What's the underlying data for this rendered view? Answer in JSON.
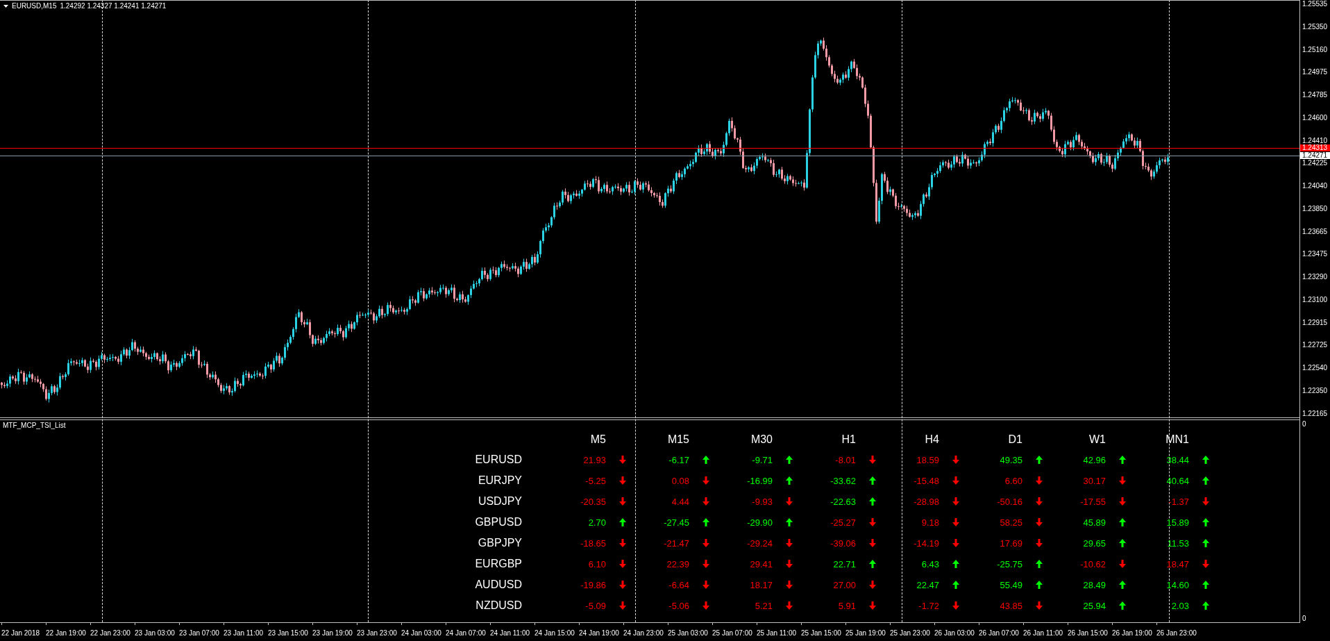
{
  "chart": {
    "symbol": "EURUSD,M15",
    "ohlc": "1.24292 1.24327 1.24241 1.24271",
    "ask_label": "1.24313",
    "bid_label": "1.24271"
  },
  "price_axis": {
    "labels": [
      "1.25535",
      "1.25350",
      "1.25160",
      "1.24975",
      "1.24785",
      "1.24600",
      "1.24410",
      "1.24225",
      "1.24040",
      "1.23850",
      "1.23665",
      "1.23475",
      "1.23290",
      "1.23100",
      "1.22915",
      "1.22725",
      "1.22540",
      "1.22350",
      "1.22165"
    ]
  },
  "indicator": {
    "name": "MTF_MCP_TSI_List",
    "axis_labels": [
      "0",
      "0"
    ],
    "timeframes": [
      "M5",
      "M15",
      "M30",
      "H1",
      "H4",
      "D1",
      "W1",
      "MN1"
    ],
    "rows": [
      {
        "symbol": "EURUSD",
        "cells": [
          {
            "value": "21.93",
            "rising": false
          },
          {
            "value": "-6.17",
            "rising": true
          },
          {
            "value": "-9.71",
            "rising": true
          },
          {
            "value": "-8.01",
            "rising": false
          },
          {
            "value": "18.59",
            "rising": false
          },
          {
            "value": "49.35",
            "rising": true
          },
          {
            "value": "42.96",
            "rising": true
          },
          {
            "value": "38.44",
            "rising": true
          }
        ]
      },
      {
        "symbol": "EURJPY",
        "cells": [
          {
            "value": "-5.25",
            "rising": false
          },
          {
            "value": "0.08",
            "rising": false
          },
          {
            "value": "-16.99",
            "rising": true
          },
          {
            "value": "-33.62",
            "rising": true
          },
          {
            "value": "-15.48",
            "rising": false
          },
          {
            "value": "6.60",
            "rising": false
          },
          {
            "value": "30.17",
            "rising": false
          },
          {
            "value": "40.64",
            "rising": true
          }
        ]
      },
      {
        "symbol": "USDJPY",
        "cells": [
          {
            "value": "-20.35",
            "rising": false
          },
          {
            "value": "4.44",
            "rising": false
          },
          {
            "value": "-9.93",
            "rising": false
          },
          {
            "value": "-22.63",
            "rising": true
          },
          {
            "value": "-28.98",
            "rising": false
          },
          {
            "value": "-50.16",
            "rising": false
          },
          {
            "value": "-17.55",
            "rising": false
          },
          {
            "value": "-1.37",
            "rising": false
          }
        ]
      },
      {
        "symbol": "GBPUSD",
        "cells": [
          {
            "value": "2.70",
            "rising": true
          },
          {
            "value": "-27.45",
            "rising": true
          },
          {
            "value": "-29.90",
            "rising": true
          },
          {
            "value": "-25.27",
            "rising": false
          },
          {
            "value": "9.18",
            "rising": false
          },
          {
            "value": "58.25",
            "rising": false
          },
          {
            "value": "45.89",
            "rising": true
          },
          {
            "value": "15.89",
            "rising": true
          }
        ]
      },
      {
        "symbol": "GBPJPY",
        "cells": [
          {
            "value": "-18.65",
            "rising": false
          },
          {
            "value": "-21.47",
            "rising": false
          },
          {
            "value": "-29.24",
            "rising": false
          },
          {
            "value": "-39.06",
            "rising": false
          },
          {
            "value": "-14.19",
            "rising": false
          },
          {
            "value": "17.69",
            "rising": false
          },
          {
            "value": "29.65",
            "rising": true
          },
          {
            "value": "11.53",
            "rising": true
          }
        ]
      },
      {
        "symbol": "EURGBP",
        "cells": [
          {
            "value": "6.10",
            "rising": false
          },
          {
            "value": "22.39",
            "rising": false
          },
          {
            "value": "29.41",
            "rising": false
          },
          {
            "value": "22.71",
            "rising": true
          },
          {
            "value": "6.43",
            "rising": true
          },
          {
            "value": "-25.75",
            "rising": true
          },
          {
            "value": "-10.62",
            "rising": false
          },
          {
            "value": "18.47",
            "rising": false
          }
        ]
      },
      {
        "symbol": "AUDUSD",
        "cells": [
          {
            "value": "-19.86",
            "rising": false
          },
          {
            "value": "-6.64",
            "rising": false
          },
          {
            "value": "18.17",
            "rising": false
          },
          {
            "value": "27.00",
            "rising": false
          },
          {
            "value": "22.47",
            "rising": true
          },
          {
            "value": "55.49",
            "rising": true
          },
          {
            "value": "28.49",
            "rising": true
          },
          {
            "value": "14.60",
            "rising": true
          }
        ]
      },
      {
        "symbol": "NZDUSD",
        "cells": [
          {
            "value": "-5.09",
            "rising": false
          },
          {
            "value": "-5.06",
            "rising": false
          },
          {
            "value": "5.21",
            "rising": false
          },
          {
            "value": "5.91",
            "rising": false
          },
          {
            "value": "-1.72",
            "rising": false
          },
          {
            "value": "43.85",
            "rising": false
          },
          {
            "value": "25.94",
            "rising": true
          },
          {
            "value": "2.03",
            "rising": true
          }
        ]
      }
    ]
  },
  "time_axis": {
    "labels": [
      "22 Jan 2018",
      "22 Jan 19:00",
      "22 Jan 23:00",
      "23 Jan 03:00",
      "23 Jan 07:00",
      "23 Jan 11:00",
      "23 Jan 15:00",
      "23 Jan 19:00",
      "23 Jan 23:00",
      "24 Jan 03:00",
      "24 Jan 07:00",
      "24 Jan 11:00",
      "24 Jan 15:00",
      "24 Jan 19:00",
      "24 Jan 23:00",
      "25 Jan 03:00",
      "25 Jan 07:00",
      "25 Jan 11:00",
      "25 Jan 15:00",
      "25 Jan 19:00",
      "25 Jan 23:00",
      "26 Jan 03:00",
      "26 Jan 07:00",
      "26 Jan 11:00",
      "26 Jan 15:00",
      "26 Jan 19:00",
      "26 Jan 23:00"
    ]
  }
}
